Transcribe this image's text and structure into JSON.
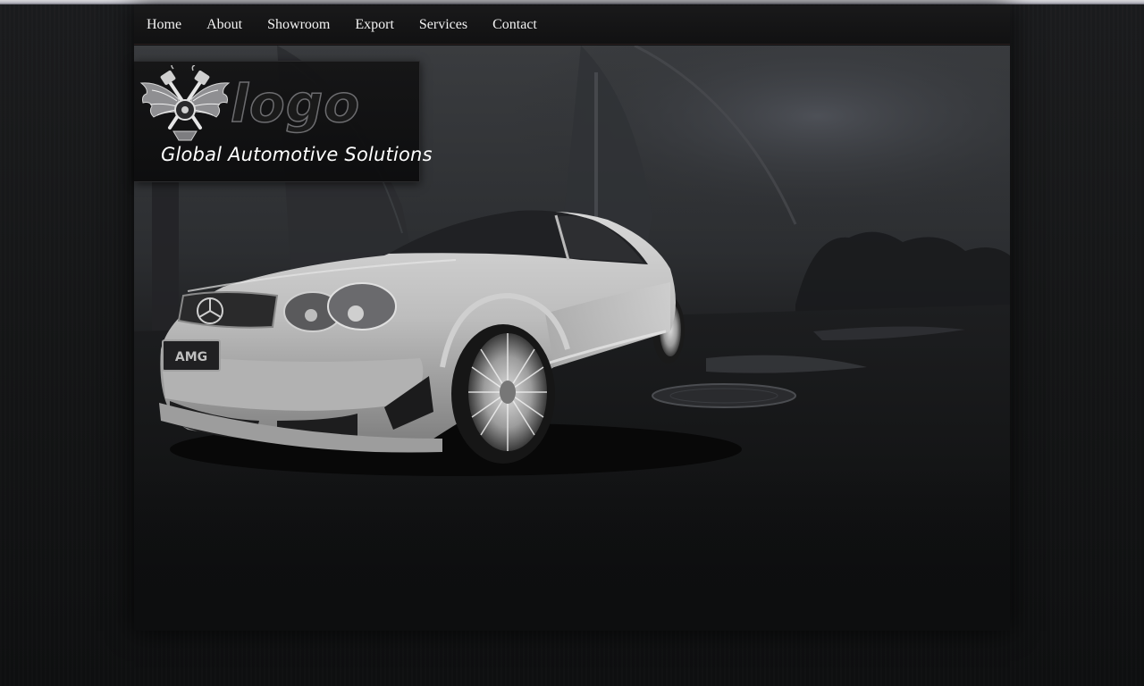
{
  "nav": {
    "items": [
      {
        "label": "Home"
      },
      {
        "label": "About"
      },
      {
        "label": "Showroom"
      },
      {
        "label": "Export"
      },
      {
        "label": "Services"
      },
      {
        "label": "Contact"
      }
    ]
  },
  "logo": {
    "emblem_icon": "winged-piston-emblem-icon",
    "word": "logo",
    "tagline": "Global Automotive Solutions"
  },
  "hero": {
    "image": "silver-sports-car-photo",
    "plate_text": "AMG"
  },
  "colors": {
    "background": "#121314",
    "nav_text": "#f2f2f2",
    "tagline": "#ffffff"
  }
}
